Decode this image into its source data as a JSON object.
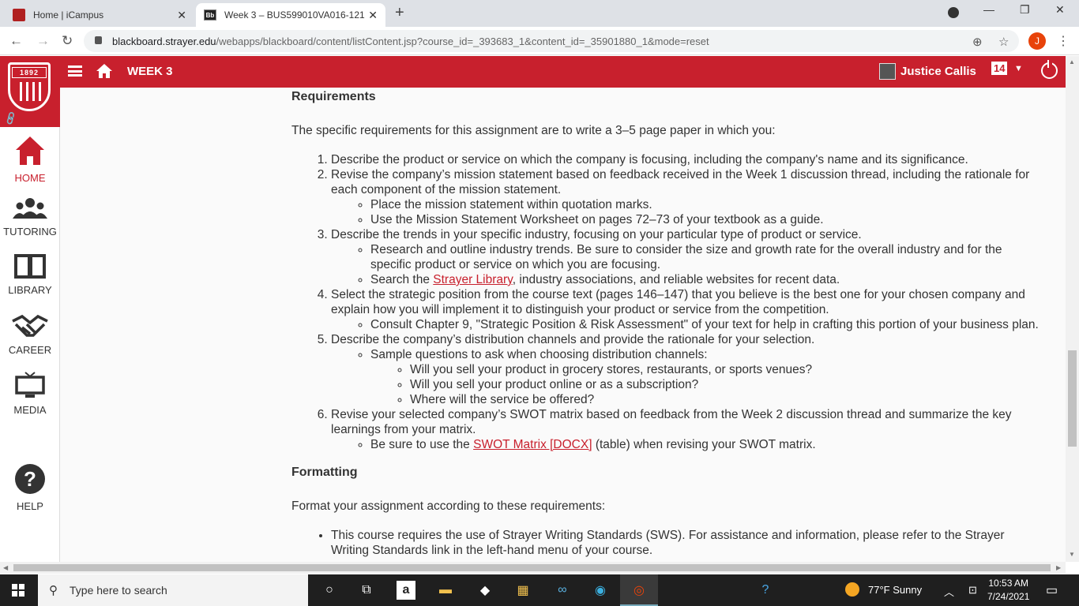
{
  "browser": {
    "tabs": [
      {
        "title": "Home | iCampus",
        "active": false
      },
      {
        "title": "Week 3 – BUS599010VA016-121",
        "active": true,
        "favicon_text": "Bb"
      }
    ],
    "url_host": "blackboard.strayer.edu",
    "url_path": "/webapps/blackboard/content/listContent.jsp?course_id=_393683_1&content_id=_35901880_1&mode=reset",
    "profile_initial": "J"
  },
  "header": {
    "logo_year": "1892",
    "breadcrumb": "WEEK 3",
    "user_name": "Justice Callis",
    "notification_count": "14"
  },
  "sidebar": {
    "items": [
      {
        "label": "HOME",
        "icon": "home-icon"
      },
      {
        "label": "TUTORING",
        "icon": "people-icon"
      },
      {
        "label": "LIBRARY",
        "icon": "book-icon"
      },
      {
        "label": "CAREER",
        "icon": "handshake-icon"
      },
      {
        "label": "MEDIA",
        "icon": "monitor-icon"
      },
      {
        "label": "HELP",
        "icon": "question-icon"
      }
    ]
  },
  "content": {
    "requirements_heading": "Requirements",
    "requirements_intro": "The specific requirements for this assignment are to write a 3–5 page paper in which you:",
    "r1": "Describe the product or service on which the company is focusing, including the company's name and its significance.",
    "r2": "Revise the company’s mission statement based on feedback received in the Week 1 discussion thread, including the rationale for each component of the mission statement.",
    "r2a": "Place the mission statement within quotation marks.",
    "r2b": "Use the Mission Statement Worksheet on pages 72–73 of your textbook as a guide.",
    "r3": "Describe the trends in your specific industry, focusing on your particular type of product or service.",
    "r3a": "Research and outline industry trends. Be sure to consider the size and growth rate for the overall industry and for the specific product or service on which you are focusing.",
    "r3b_pre": "Search the ",
    "r3b_link": "Strayer Library",
    "r3b_post": ", industry associations, and reliable websites for recent data.",
    "r4": "Select the strategic position from the course text (pages 146–147) that you believe is the best one for your chosen company and explain how you will implement it to distinguish your product or service from the competition.",
    "r4a": "Consult Chapter 9, \"Strategic Position & Risk Assessment\" of your text for help in crafting this portion of your business plan.",
    "r5": "Describe the company’s distribution channels and provide the rationale for your selection.",
    "r5a": "Sample questions to ask when choosing distribution channels:",
    "r5a1": "Will you sell your product in grocery stores, restaurants, or sports venues?",
    "r5a2": "Will you sell your product online or as a subscription?",
    "r5a3": "Where will the service be offered?",
    "r6": "Revise your selected company’s SWOT matrix based on feedback from the Week 2 discussion thread and summarize the key learnings from your matrix.",
    "r6a_pre": "Be sure to use the ",
    "r6a_link": "SWOT Matrix [DOCX]",
    "r6a_post": " (table) when revising your SWOT matrix.",
    "formatting_heading": "Formatting",
    "formatting_intro": "Format your assignment according to these requirements:",
    "f1": "This course requires the use of Strayer Writing Standards (SWS). For assistance and information, please refer to the Strayer Writing Standards link in the left-hand menu of your course."
  },
  "taskbar": {
    "search_placeholder": "Type here to search",
    "weather": "77°F  Sunny",
    "time": "10:53 AM",
    "date": "7/24/2021"
  },
  "colors": {
    "brand_red": "#c8202d",
    "link_red": "#c8202d"
  }
}
